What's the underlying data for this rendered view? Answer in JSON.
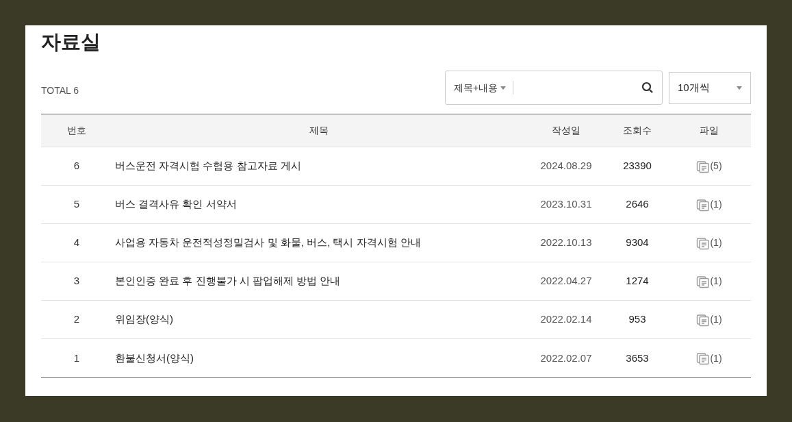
{
  "page": {
    "title": "자료실",
    "total": "TOTAL 6"
  },
  "search": {
    "scope": "제목+내용"
  },
  "page_size": {
    "value": "10개씩"
  },
  "table": {
    "columns": [
      "번호",
      "제목",
      "작성일",
      "조회수",
      "파일"
    ],
    "rows": [
      {
        "no": "6",
        "title": "버스운전 자격시험 수험용 참고자료 게시",
        "date": "2024.08.29",
        "views": "23390",
        "files": "(5)"
      },
      {
        "no": "5",
        "title": "버스 결격사유 확인 서약서",
        "date": "2023.10.31",
        "views": "2646",
        "files": "(1)"
      },
      {
        "no": "4",
        "title": "사업용 자동차 운전적성정밀검사 및 화물, 버스, 택시 자격시험 안내",
        "date": "2022.10.13",
        "views": "9304",
        "files": "(1)"
      },
      {
        "no": "3",
        "title": "본인인증 완료 후 진행불가 시 팝업해제 방법 안내",
        "date": "2022.04.27",
        "views": "1274",
        "files": "(1)"
      },
      {
        "no": "2",
        "title": "위임장(양식)",
        "date": "2022.02.14",
        "views": "953",
        "files": "(1)"
      },
      {
        "no": "1",
        "title": "환불신청서(양식)",
        "date": "2022.02.07",
        "views": "3653",
        "files": "(1)"
      }
    ]
  }
}
